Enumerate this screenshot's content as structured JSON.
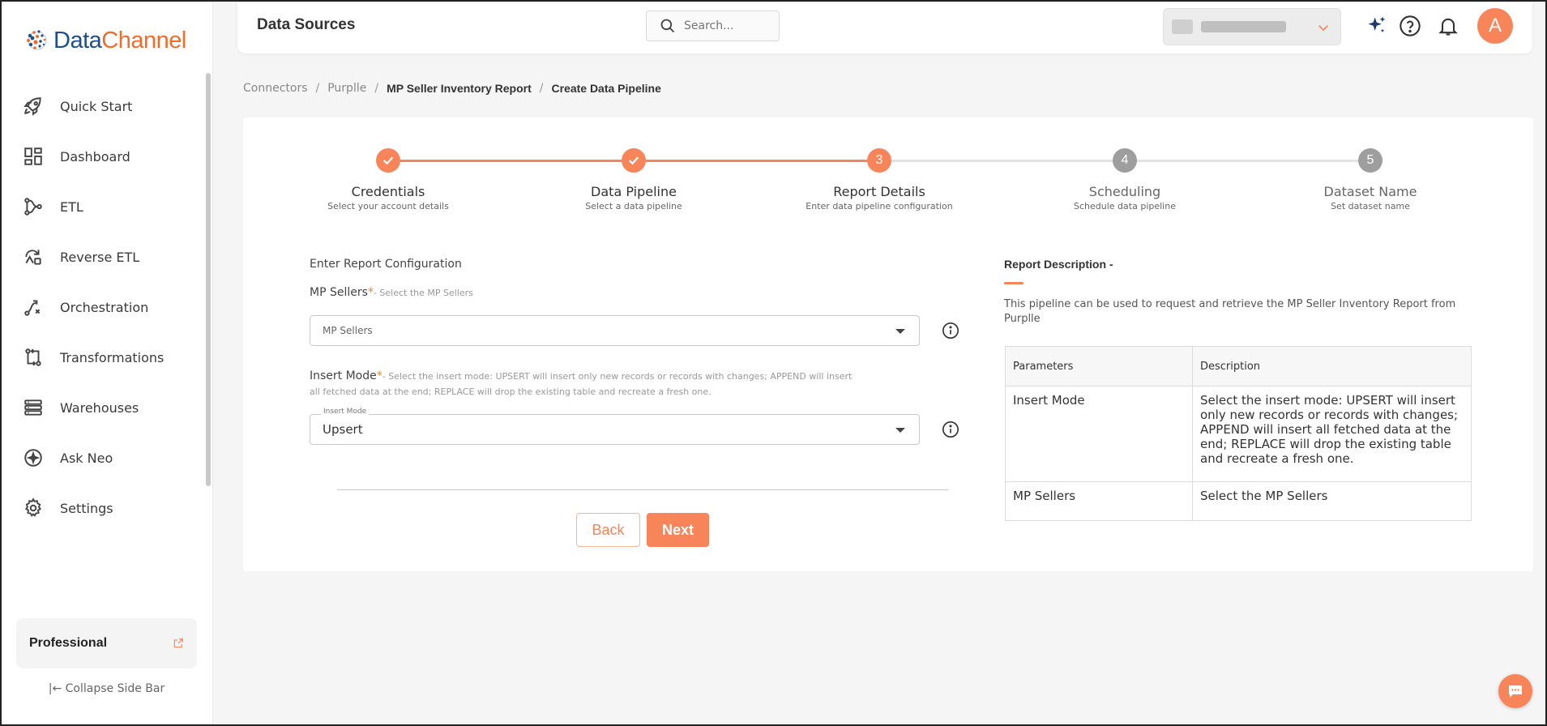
{
  "brand": {
    "name_part1": "Data",
    "name_part2": "Channel"
  },
  "sidebar": {
    "items": [
      {
        "label": "Quick Start",
        "icon": "rocket-icon"
      },
      {
        "label": "Dashboard",
        "icon": "dashboard-icon"
      },
      {
        "label": "ETL",
        "icon": "etl-icon"
      },
      {
        "label": "Reverse ETL",
        "icon": "reverse-etl-icon"
      },
      {
        "label": "Orchestration",
        "icon": "orchestration-icon"
      },
      {
        "label": "Transformations",
        "icon": "transformations-icon"
      },
      {
        "label": "Warehouses",
        "icon": "warehouses-icon"
      },
      {
        "label": "Ask Neo",
        "icon": "ask-neo-icon"
      },
      {
        "label": "Settings",
        "icon": "gear-icon"
      }
    ],
    "plan": "Professional",
    "collapse_label": "Collapse Side Bar"
  },
  "header": {
    "title": "Data Sources",
    "search_placeholder": "Search...",
    "avatar_letter": "A"
  },
  "breadcrumb": {
    "items": [
      "Connectors",
      "Purplle",
      "MP Seller Inventory Report",
      "Create Data Pipeline"
    ]
  },
  "stepper": {
    "steps": [
      {
        "title": "Credentials",
        "subtitle": "Select your account details",
        "number": "1",
        "state": "done"
      },
      {
        "title": "Data Pipeline",
        "subtitle": "Select a data pipeline",
        "number": "2",
        "state": "done"
      },
      {
        "title": "Report Details",
        "subtitle": "Enter data pipeline configuration",
        "number": "3",
        "state": "active"
      },
      {
        "title": "Scheduling",
        "subtitle": "Schedule data pipeline",
        "number": "4",
        "state": "future"
      },
      {
        "title": "Dataset Name",
        "subtitle": "Set dataset name",
        "number": "5",
        "state": "future"
      }
    ]
  },
  "form": {
    "heading": "Enter Report Configuration",
    "mp_sellers": {
      "label": "MP Sellers",
      "required": "*",
      "hint": "- Select the MP Sellers",
      "placeholder": "MP Sellers"
    },
    "insert_mode": {
      "label": "Insert Mode",
      "required": "*",
      "hint_line1": "- Select the insert mode: UPSERT will insert only new records or records with changes; APPEND will insert",
      "hint_line2": "all fetched data at the end; REPLACE will drop the existing table and recreate a fresh one.",
      "float_label": "Insert Mode",
      "value": "Upsert"
    },
    "back_label": "Back",
    "next_label": "Next"
  },
  "description": {
    "title": "Report Description -",
    "text": "This pipeline can be used to request and retrieve the MP Seller Inventory Report from Purplle",
    "table_headers": [
      "Parameters",
      "Description"
    ],
    "rows": [
      {
        "param": "Insert Mode",
        "desc": "Select the insert mode: UPSERT will insert only new records or records with changes; APPEND will insert all fetched data at the end; REPLACE will drop the existing table and recreate a fresh one."
      },
      {
        "param": "MP Sellers",
        "desc": "Select the MP Sellers"
      }
    ]
  },
  "colors": {
    "accent": "#f8845a",
    "step_done": "#f8845a",
    "step_future": "#9e9e9e",
    "line_inactive": "#e2e2e2"
  }
}
